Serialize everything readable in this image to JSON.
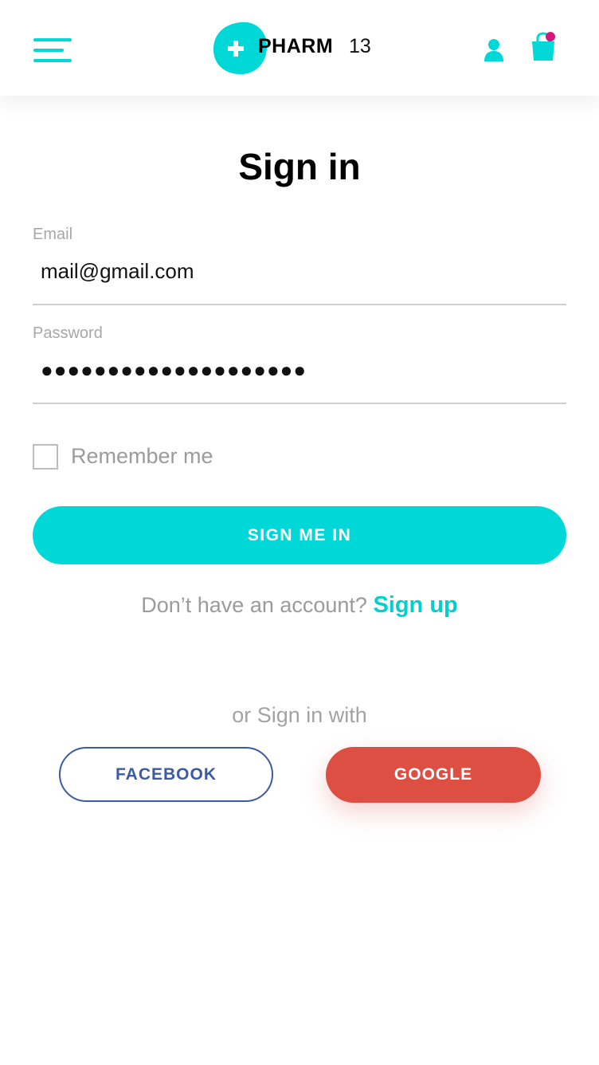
{
  "header": {
    "brand": "PHARM",
    "brand_number": "13",
    "menu_icon": "hamburger-icon",
    "user_icon": "user-icon",
    "cart_icon": "shopping-bag-icon",
    "accent_color": "#00d7d7",
    "cart_badge_color": "#d4177a"
  },
  "title": "Sign in",
  "form": {
    "email_label": "Email",
    "email_value": "mail@gmail.com",
    "password_label": "Password",
    "password_value": "●●●●●●●●●●●●●●●●●●●●",
    "remember_label": "Remember me",
    "submit_label": "SIGN ME IN"
  },
  "signup": {
    "prompt": "Don’t have an account?",
    "link": "Sign up"
  },
  "social": {
    "prompt": "or Sign in with",
    "facebook_label": "FACEBOOK",
    "google_label": "GOOGLE",
    "facebook_color": "#3b5ba5",
    "google_color": "#dc4f42"
  }
}
